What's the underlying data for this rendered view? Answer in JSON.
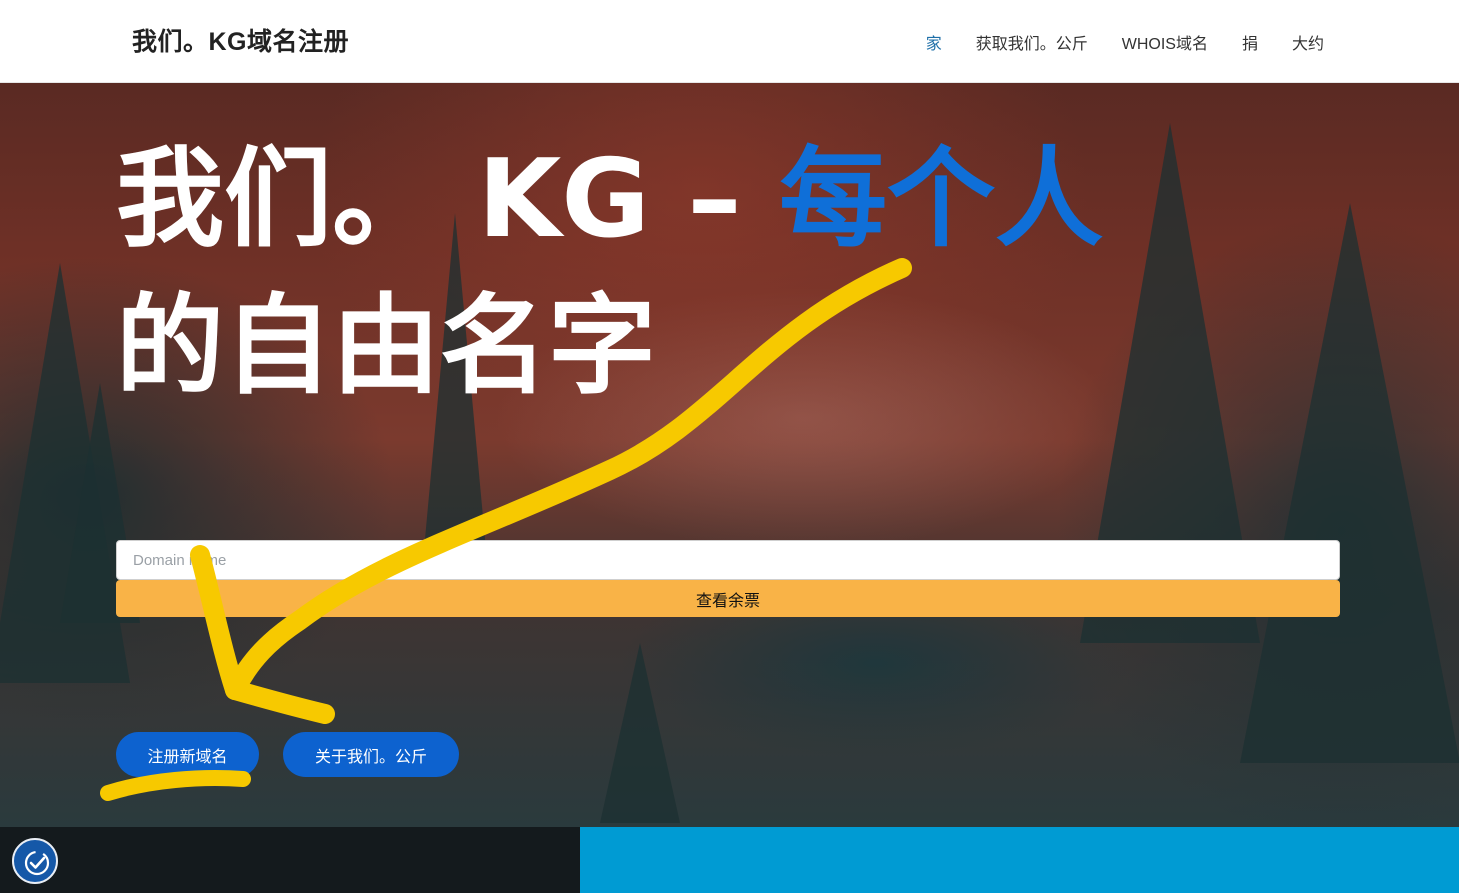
{
  "header": {
    "brand": "我们。KG域名注册",
    "nav": [
      {
        "label": "家",
        "active": true
      },
      {
        "label": "获取我们。公斤",
        "active": false
      },
      {
        "label": "WHOIS域名",
        "active": false
      },
      {
        "label": "捐",
        "active": false
      },
      {
        "label": "大约",
        "active": false
      }
    ]
  },
  "hero": {
    "headline_part1": "我们。 KG – ",
    "headline_accent": "每个人",
    "headline_line2": "的自由名字",
    "search": {
      "placeholder": "Domain name",
      "button_label": "查看余票"
    },
    "buttons": {
      "register_label": "注册新域名",
      "about_label": "关于我们。公斤"
    }
  },
  "accessibility": {
    "icon": "accessibility-check-icon"
  },
  "colors": {
    "accent_blue": "#0f6fd8",
    "button_blue": "#0d62cf",
    "check_button": "#f9b347",
    "annotation_yellow": "#f7c900",
    "footer_dark": "#141a1d",
    "footer_blue": "#009bd3"
  }
}
